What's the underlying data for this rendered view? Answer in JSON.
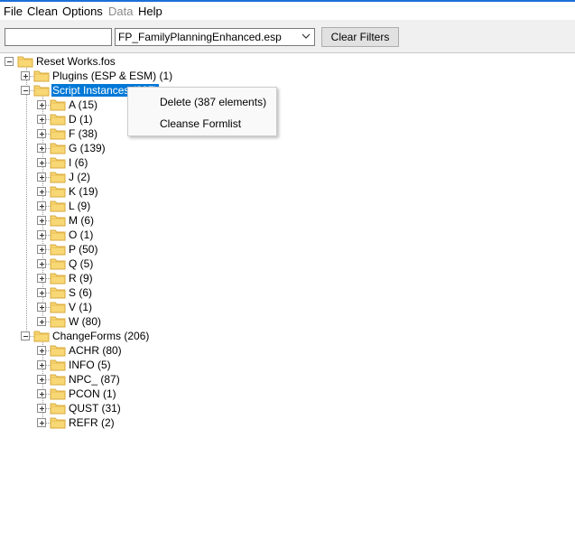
{
  "menu": {
    "file": "File",
    "clean": "Clean",
    "options": "Options",
    "data": "Data",
    "help": "Help"
  },
  "toolbar": {
    "filter_value": "",
    "plugin_select": "FP_FamilyPlanningEnhanced.esp",
    "clear_filters": "Clear Filters"
  },
  "tree": {
    "root": "Reset Works.fos",
    "plugins": "Plugins (ESP & ESM) (1)",
    "script_instances": "Script Instances (387)",
    "script_children": [
      "A (15)",
      "D (1)",
      "F (38)",
      "G (139)",
      "I (6)",
      "J (2)",
      "K (19)",
      "L (9)",
      "M (6)",
      "O (1)",
      "P (50)",
      "Q (5)",
      "R (9)",
      "S (6)",
      "V (1)",
      "W (80)"
    ],
    "change_forms": "ChangeForms (206)",
    "change_children": [
      "ACHR (80)",
      "INFO (5)",
      "NPC_ (87)",
      "PCON (1)",
      "QUST (31)",
      "REFR (2)"
    ]
  },
  "context_menu": {
    "delete": "Delete (387 elements)",
    "cleanse": "Cleanse Formlist"
  },
  "colors": {
    "selection": "#0078d7",
    "folder": "#f8d775",
    "titlebar_accent": "#1d6fd6"
  }
}
